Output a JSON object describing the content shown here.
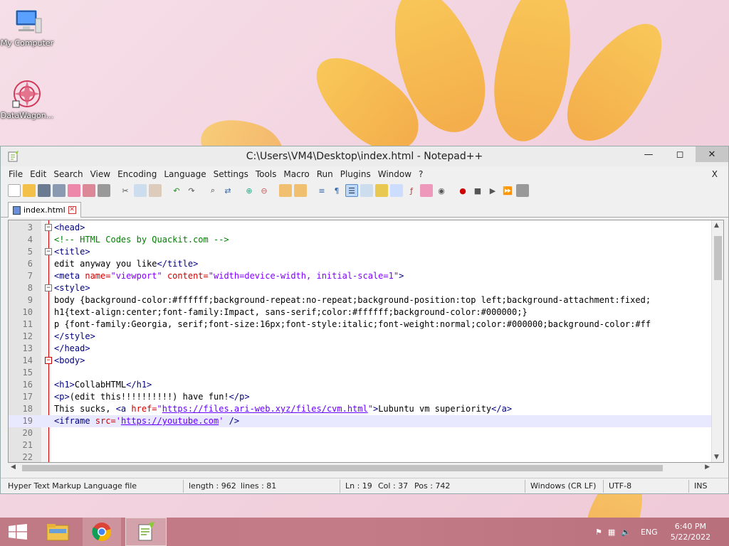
{
  "desktop": {
    "icons": [
      {
        "label": "My Computer"
      },
      {
        "label": "DataWagon..."
      }
    ]
  },
  "window": {
    "title": "C:\\Users\\VM4\\Desktop\\index.html - Notepad++"
  },
  "menu": [
    "File",
    "Edit",
    "Search",
    "View",
    "Encoding",
    "Language",
    "Settings",
    "Tools",
    "Macro",
    "Run",
    "Plugins",
    "Window",
    "?"
  ],
  "menu_close": "X",
  "tab": {
    "label": "index.html"
  },
  "editor": {
    "lines": [
      {
        "n": "3"
      },
      {
        "n": "4"
      },
      {
        "n": "5"
      },
      {
        "n": "6"
      },
      {
        "n": "7"
      },
      {
        "n": "8"
      },
      {
        "n": "9"
      },
      {
        "n": "10"
      },
      {
        "n": "11"
      },
      {
        "n": "12"
      },
      {
        "n": "13"
      },
      {
        "n": "14"
      },
      {
        "n": "15"
      },
      {
        "n": "16"
      },
      {
        "n": "17"
      },
      {
        "n": "18"
      },
      {
        "n": "19"
      },
      {
        "n": "20"
      },
      {
        "n": "21"
      },
      {
        "n": "22"
      }
    ],
    "code": {
      "l3": "<head>",
      "l4": "<!-- HTML Codes by Quackit.com -->",
      "l5": "<title>",
      "l6a": "edit anyway you like",
      "l6b": "</title>",
      "l7a": "<meta ",
      "l7b": "name=",
      "l7c": "\"viewport\"",
      "l7d": " content=",
      "l7e": "\"width=device-width, initial-scale=1\"",
      "l7f": ">",
      "l8": "<style>",
      "l9": "body {background-color:#ffffff;background-repeat:no-repeat;background-position:top left;background-attachment:fixed;",
      "l10": "h1{text-align:center;font-family:Impact, sans-serif;color:#ffffff;background-color:#000000;}",
      "l11": "p {font-family:Georgia, serif;font-size:16px;font-style:italic;font-weight:normal;color:#000000;background-color:#ff",
      "l12": "</style>",
      "l13": "</head>",
      "l14": "<body>",
      "l16a": "<h1>",
      "l16b": "CollabHTML",
      "l16c": "</h1>",
      "l17a": "<p>",
      "l17b": "(edit this!!!!!!!!!!) have fun!",
      "l17c": "</p>",
      "l18a": "This sucks, ",
      "l18b": "<a ",
      "l18c": "href=",
      "l18d": "\"",
      "l18e": "https://files.ari-web.xyz/files/cvm.html",
      "l18f": "\"",
      "l18g": ">",
      "l18h": "Lubuntu vm superiority",
      "l18i": "</a>",
      "l19a": "<iframe ",
      "l19b": "src=",
      "l19c": "'",
      "l19d": "https://youtube.com",
      "l19e": "'",
      "l19f": " />"
    }
  },
  "status": {
    "filetype": "Hyper Text Markup Language file",
    "length": "length : 962",
    "lines": "lines : 81",
    "ln": "Ln : 19",
    "col": "Col : 37",
    "pos": "Pos : 742",
    "eol": "Windows (CR LF)",
    "enc": "UTF-8",
    "ins": "INS"
  },
  "taskbar": {
    "lang": "ENG",
    "time": "6:40 PM",
    "date": "5/22/2022"
  }
}
